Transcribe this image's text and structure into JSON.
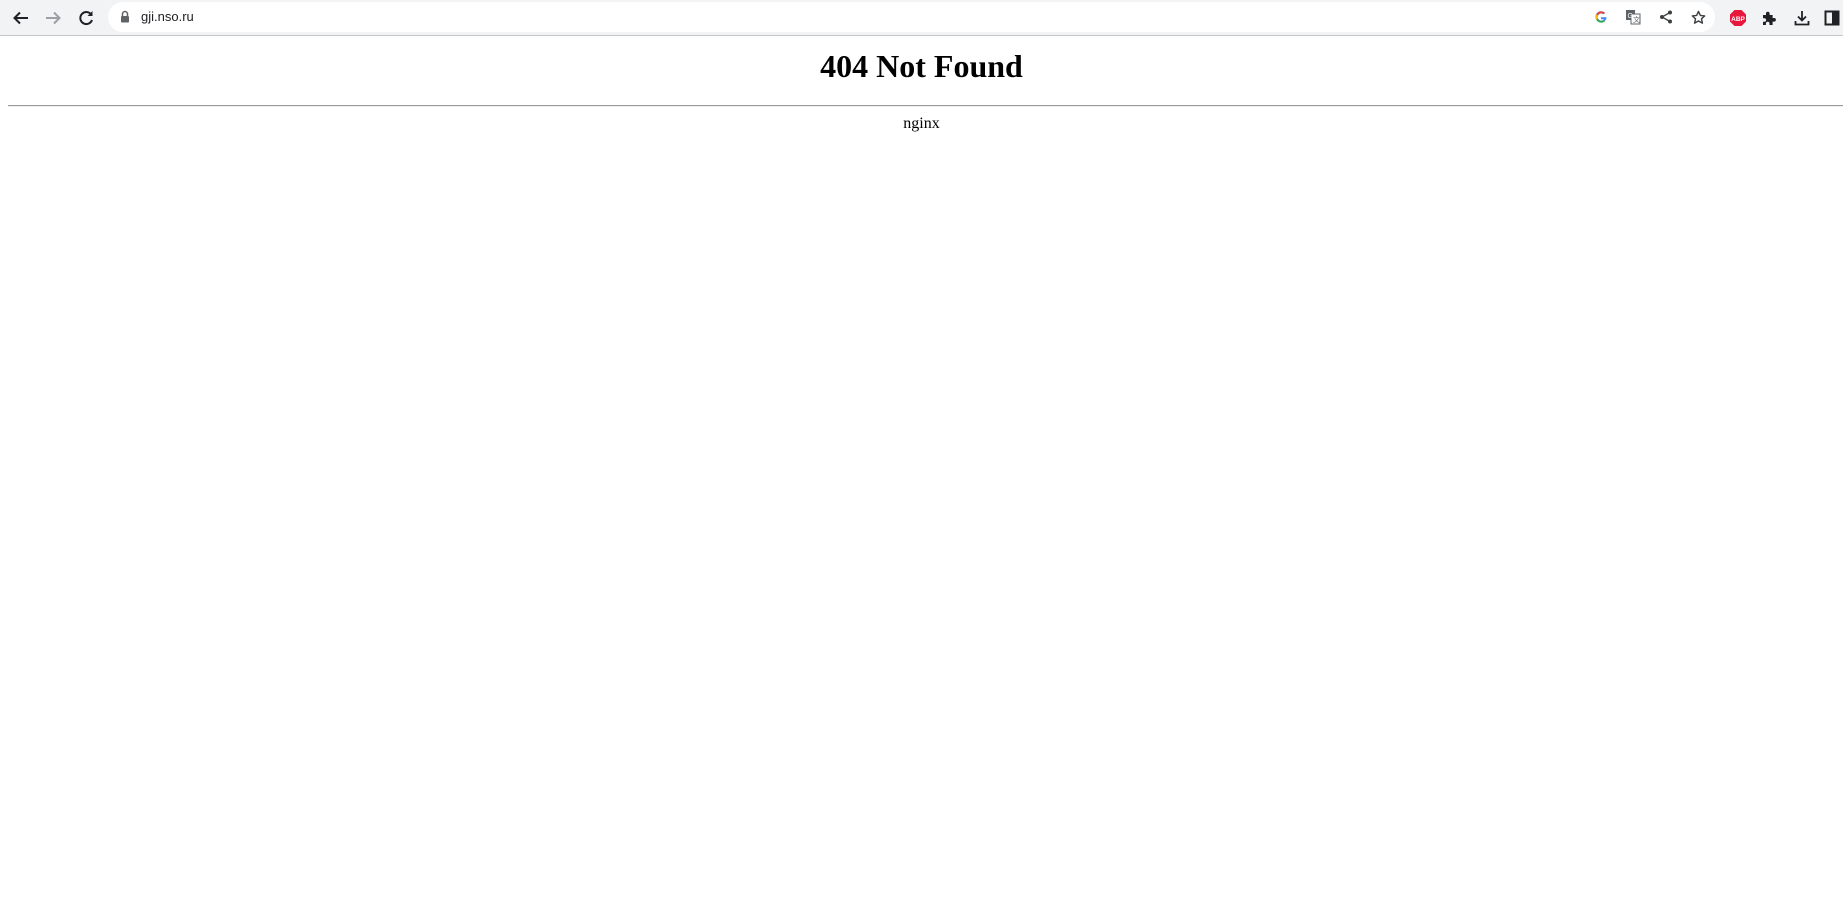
{
  "browser": {
    "url": "gji.nso.ru",
    "icons": [
      "back-icon",
      "forward-icon",
      "reload-icon",
      "lock-icon",
      "google-icon",
      "translate-icon",
      "share-icon",
      "star-icon",
      "adblock-plus-icon",
      "extensions-icon",
      "download-icon",
      "side-panel-icon"
    ],
    "abp_label": "ABP"
  },
  "page": {
    "heading": "404 Not Found",
    "server": "nginx"
  }
}
